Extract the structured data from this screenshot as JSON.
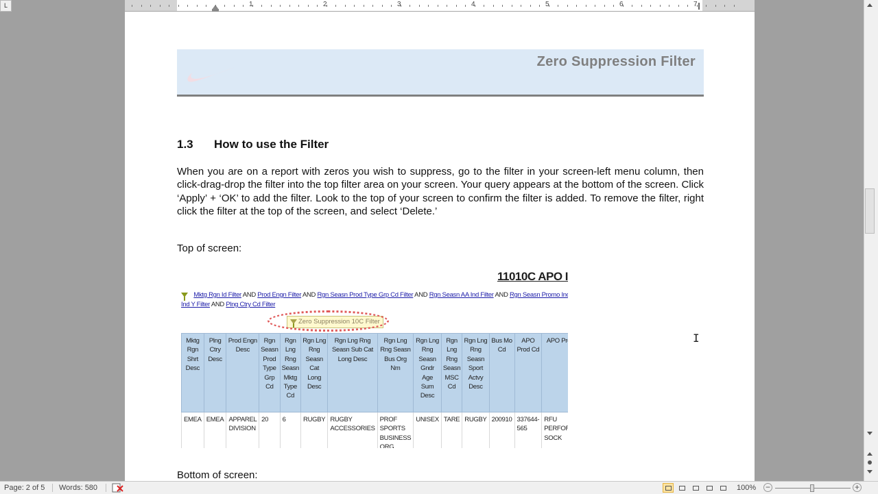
{
  "ruler": {
    "corner_label": "L",
    "numbers": [
      "1",
      "2",
      "3",
      "4",
      "5",
      "6",
      "7"
    ]
  },
  "header": {
    "title": "Zero Suppression Filter",
    "logo_icon": "swoosh-logo"
  },
  "section": {
    "number": "1.3",
    "title": "How to use the Filter"
  },
  "body_text": "When you are on a report with zeros you wish to suppress, go to the filter in your screen-left menu column, then click-drag-drop the filter into the top filter area on your screen. Your query appears at the bottom of the screen. Click ‘Apply’ + ‘OK’ to add the filter. Look to the top of your screen to confirm the filter is added.  To remove the filter, right click the filter at the top of the screen, and select ‘Delete.’",
  "top_label": "Top of screen:",
  "bottom_label": "Bottom of screen:",
  "screenshot": {
    "report_title": "11010C APO I",
    "filter_line1": [
      "Mktg Rgn Id Filter",
      "Prod Engn Filter",
      "Rgn Seasn Prod Type Grp Cd Filter",
      "Rgn Seasn AA Ind Filter",
      "Rgn Seasn Promo Ind Filter"
    ],
    "filter_line2": [
      "Ind Y Filter",
      "Plng Ctry Cd Filter"
    ],
    "and_word": "AND",
    "trailing_a": "A",
    "zero_filter_chip": "Zero Suppression 10C Filter",
    "columns": [
      "Mktg Rgn Shrt Desc",
      "Plng Ctry Desc",
      "Prod Engn Desc",
      "Rgn Seasn Prod Type Grp Cd",
      "Rgn Lng Rng Seasn Mktg Type Cd",
      "Rgn Lng Rng Seasn Cat Long Desc",
      "Rgn Lng Rng Seasn Sub Cat Long Desc",
      "Rgn Lng Rng Seasn Bus Org Nm",
      "Rgn Lng Rng Seasn Gndr Age Sum Desc",
      "Rgn Lng Rng Seasn MSC Cd",
      "Rgn Lng Rng Seasn Sport Actvy Desc",
      "Bus Mo Cd",
      "APO Prod Cd",
      "APO Prod Desc"
    ],
    "row": [
      "EMEA",
      "EMEA",
      "APPAREL DIVISION",
      "20",
      "6",
      "RUGBY",
      "RUGBY ACCESSORIES",
      "PROF SPORTS BUSINESS ORG",
      "UNISEX",
      "TARE",
      "RUGBY",
      "200910",
      "337644-565",
      "RFU PERFORMANCE SOCK"
    ]
  },
  "status": {
    "page": "Page: 2 of 5",
    "words": "Words: 580",
    "zoom": "100%",
    "zoom_minus": "−",
    "zoom_plus": "+"
  },
  "colors": {
    "header_band": "#dce9f6",
    "table_header": "#bcd4ea",
    "highlight_ring": "#e05a5a",
    "link": "#1a1aa8"
  }
}
